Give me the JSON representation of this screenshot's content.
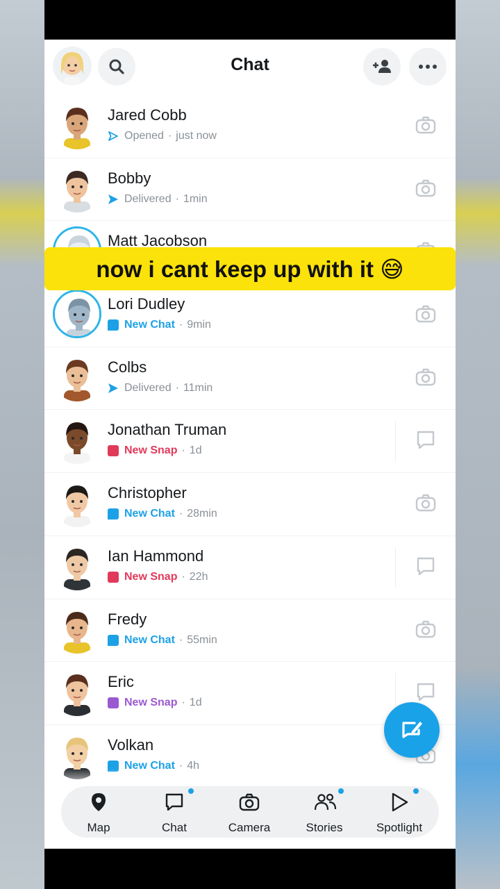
{
  "header": {
    "title": "Chat"
  },
  "overlay_caption": "now i cant keep up with it 😅",
  "chats": [
    {
      "name": "Jared Cobb",
      "status": "Opened",
      "status_kind": "sent-outline",
      "time": "just now",
      "action": "camera",
      "ring": false,
      "skin": "#d9a679",
      "hair": "#5a2f1d",
      "shirt": "#e8c42a"
    },
    {
      "name": "Bobby",
      "status": "Delivered",
      "status_kind": "sent",
      "time": "1min",
      "action": "camera",
      "ring": false,
      "skin": "#eec39d",
      "hair": "#3a2a22",
      "shirt": "#d8dde2"
    },
    {
      "name": "Matt Jacobson",
      "status": "",
      "status_kind": "none",
      "time": "",
      "action": "camera",
      "ring": true,
      "skin": "#e9eef2",
      "hair": "#c9d4dc",
      "shirt": "#eef2f5"
    },
    {
      "name": "Lori Dudley",
      "status": "New Chat",
      "status_kind": "chat",
      "time": "9min",
      "action": "camera",
      "ring": true,
      "skin": "#9fb6c8",
      "hair": "#7c93a6",
      "shirt": "#c6d3dd"
    },
    {
      "name": "Colbs",
      "status": "Delivered",
      "status_kind": "sent",
      "time": "11min",
      "action": "camera",
      "ring": false,
      "skin": "#eabf97",
      "hair": "#6b3a22",
      "shirt": "#a2582c"
    },
    {
      "name": "Jonathan Truman",
      "status": "New Snap",
      "status_kind": "snap-red",
      "time": "1d",
      "action": "chat",
      "ring": false,
      "skin": "#7a4a2a",
      "hair": "#231510",
      "shirt": "#f4f4f4"
    },
    {
      "name": "Christopher",
      "status": "New Chat",
      "status_kind": "chat",
      "time": "28min",
      "action": "camera",
      "ring": false,
      "skin": "#f0c9a4",
      "hair": "#1d1a18",
      "shirt": "#f2f2f2"
    },
    {
      "name": "Ian Hammond",
      "status": "New Snap",
      "status_kind": "snap-red",
      "time": "22h",
      "action": "chat",
      "ring": false,
      "skin": "#efc9a6",
      "hair": "#2b2622",
      "shirt": "#2f3438"
    },
    {
      "name": "Fredy",
      "status": "New Chat",
      "status_kind": "chat",
      "time": "55min",
      "action": "camera",
      "ring": false,
      "skin": "#e8b68c",
      "hair": "#4a2a1a",
      "shirt": "#e8c42a"
    },
    {
      "name": "Eric",
      "status": "New Snap",
      "status_kind": "snap-purple",
      "time": "1d",
      "action": "chat",
      "ring": false,
      "skin": "#eec39d",
      "hair": "#5a2f1d",
      "shirt": "#2b2f33"
    },
    {
      "name": "Volkan",
      "status": "New Chat",
      "status_kind": "chat",
      "time": "4h",
      "action": "camera",
      "ring": false,
      "skin": "#f2cfa5",
      "hair": "#e6c47a",
      "shirt": "#2b2f33"
    }
  ],
  "nav": [
    {
      "label": "Map",
      "icon": "map-pin-icon",
      "badge": false
    },
    {
      "label": "Chat",
      "icon": "chat-icon",
      "badge": true
    },
    {
      "label": "Camera",
      "icon": "camera-icon",
      "badge": false
    },
    {
      "label": "Stories",
      "icon": "stories-icon",
      "badge": true
    },
    {
      "label": "Spotlight",
      "icon": "spotlight-icon",
      "badge": true
    }
  ],
  "colors": {
    "accent_blue": "#1da1e6",
    "snap_red": "#e1395a",
    "snap_purple": "#9b59d0",
    "caption_yellow": "#fbe20a"
  }
}
